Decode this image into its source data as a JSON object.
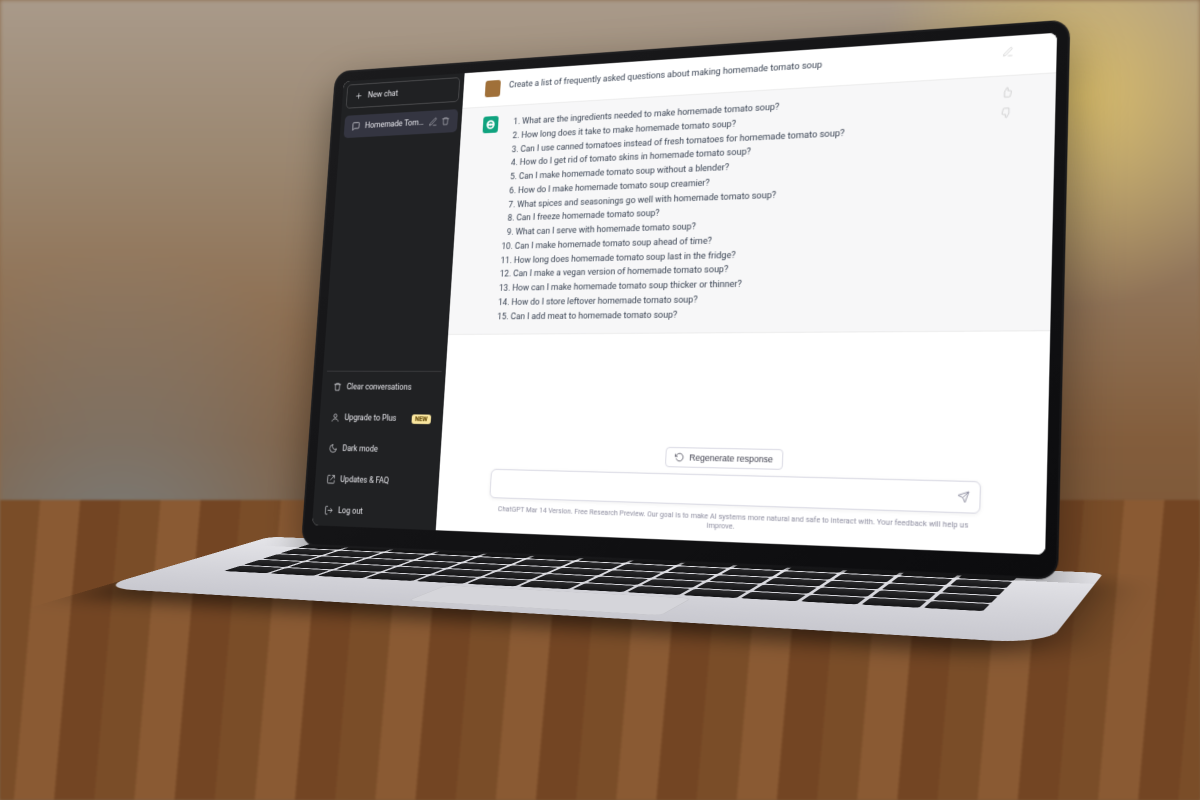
{
  "sidebar": {
    "new_chat": "New chat",
    "history": [
      {
        "title": "Homemade Tomato So…"
      }
    ],
    "footer": {
      "clear": "Clear conversations",
      "upgrade": "Upgrade to Plus",
      "upgrade_badge": "NEW",
      "dark_mode": "Dark mode",
      "updates_faq": "Updates & FAQ",
      "logout": "Log out"
    }
  },
  "conversation": {
    "user_prompt": "Create a list of frequently asked questions about making homemade tomato soup",
    "assistant_list": [
      "What are the ingredients needed to make homemade tomato soup?",
      "How long does it take to make homemade tomato soup?",
      "Can I use canned tomatoes instead of fresh tomatoes for homemade tomato soup?",
      "How do I get rid of tomato skins in homemade tomato soup?",
      "Can I make homemade tomato soup without a blender?",
      "How do I make homemade tomato soup creamier?",
      "What spices and seasonings go well with homemade tomato soup?",
      "Can I freeze homemade tomato soup?",
      "What can I serve with homemade tomato soup?",
      "Can I make homemade tomato soup ahead of time?",
      "How long does homemade tomato soup last in the fridge?",
      "Can I make a vegan version of homemade tomato soup?",
      "How can I make homemade tomato soup thicker or thinner?",
      "How do I store leftover homemade tomato soup?",
      "Can I add meat to homemade tomato soup?"
    ]
  },
  "footer": {
    "regenerate": "Regenerate response",
    "input_placeholder": "",
    "disclaimer": "ChatGPT Mar 14 Version. Free Research Preview. Our goal is to make AI systems more natural and safe to interact with. Your feedback will help us improve."
  }
}
